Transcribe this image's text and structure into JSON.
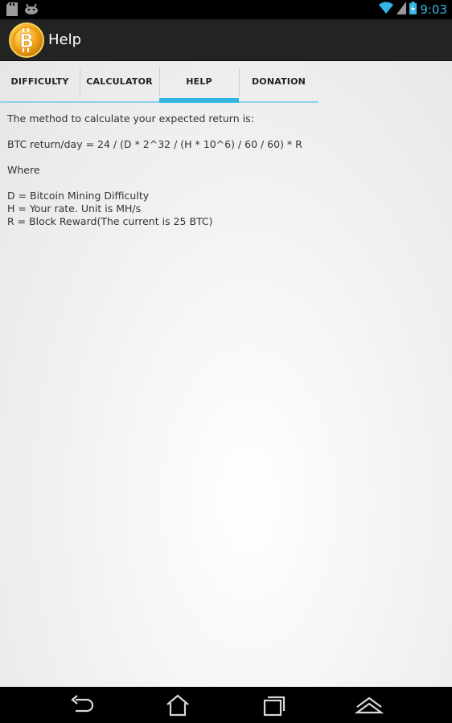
{
  "status_bar": {
    "time": "9:03",
    "left_icons": [
      "sd-card-icon",
      "android-debug-icon"
    ],
    "right_icons": [
      "wifi-icon",
      "signal-icon",
      "battery-icon"
    ],
    "accent_color": "#33b5e5"
  },
  "action_bar": {
    "title": "Help",
    "logo_icon": "bitcoin-logo-icon"
  },
  "tabs": [
    {
      "label": "DIFFICULTY",
      "selected": false
    },
    {
      "label": "CALCULATOR",
      "selected": false
    },
    {
      "label": "HELP",
      "selected": true
    },
    {
      "label": "DONATION",
      "selected": false
    }
  ],
  "help": {
    "intro": "The method to calculate your expected return is:",
    "formula": "BTC return/day = 24 / (D * 2^32 / (H * 10^6) / 60 / 60) * R",
    "where": "Where",
    "definitions": [
      "D = Bitcoin Mining Difficulty",
      "H = Your rate. Unit is MH/s",
      "R = Block Reward(The current is 25 BTC)"
    ]
  },
  "nav_bar": {
    "buttons": [
      "back-icon",
      "home-icon",
      "recent-apps-icon",
      "menu-up-icon"
    ]
  }
}
